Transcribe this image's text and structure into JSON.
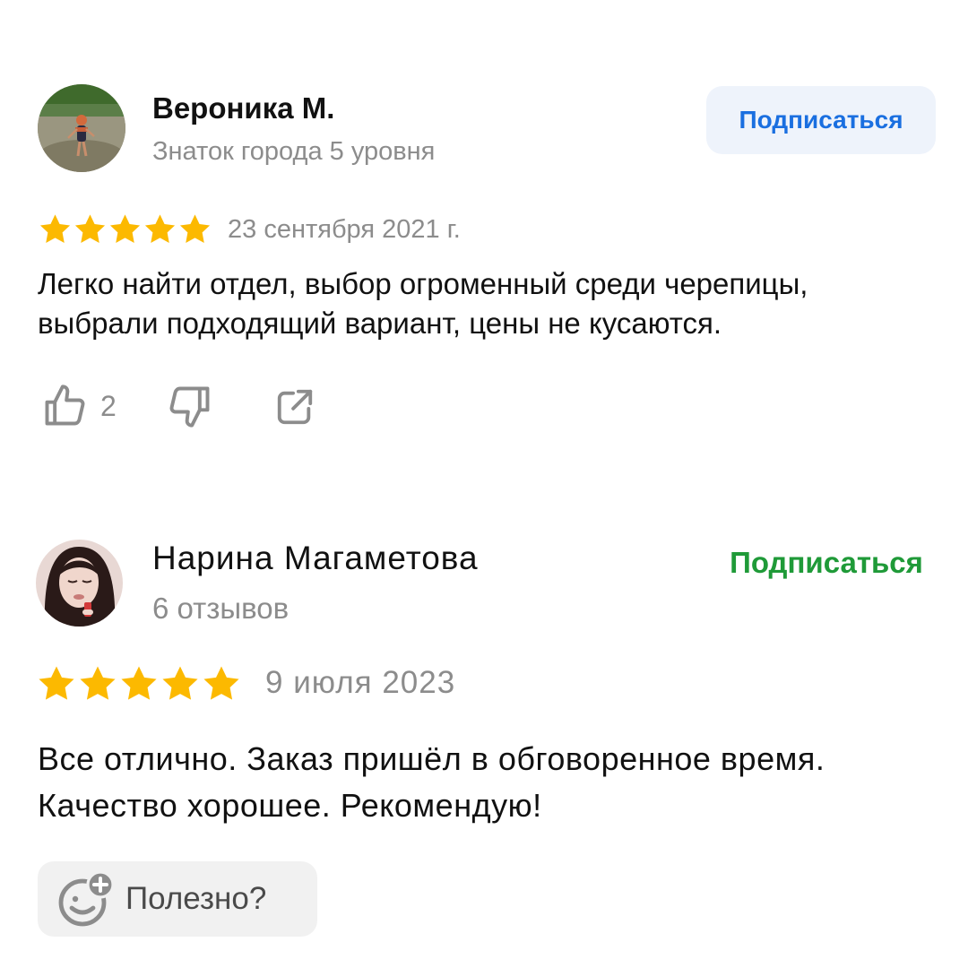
{
  "reviews": [
    {
      "author_name": "Вероника М.",
      "author_meta": "Знаток города 5 уровня",
      "subscribe_label": "Подписаться",
      "rating": 5,
      "date": "23 сентября 2021 г.",
      "text": "Легко найти отдел, выбор огроменный среди черепицы, выбрали подходящий вариант, цены не кусаются.",
      "likes": "2"
    },
    {
      "author_name": "Нарина Магаметова",
      "author_meta": "6 отзывов",
      "subscribe_label": "Подписаться",
      "rating": 5,
      "date": "9 июля 2023",
      "text": "Все отлично. Заказ пришёл в обговоренное время. Качество хорошее. Рекомендую!",
      "helpful_label": "Полезно?"
    }
  ],
  "colors": {
    "star": "#fcb900",
    "link_blue": "#1a6fe0",
    "link_green": "#1f9a38",
    "muted": "#8c8c8c",
    "button_bg": "#eef3fb"
  },
  "icons": [
    "thumbs-up-icon",
    "thumbs-down-icon",
    "share-icon",
    "add-reaction-icon",
    "star-icon"
  ]
}
